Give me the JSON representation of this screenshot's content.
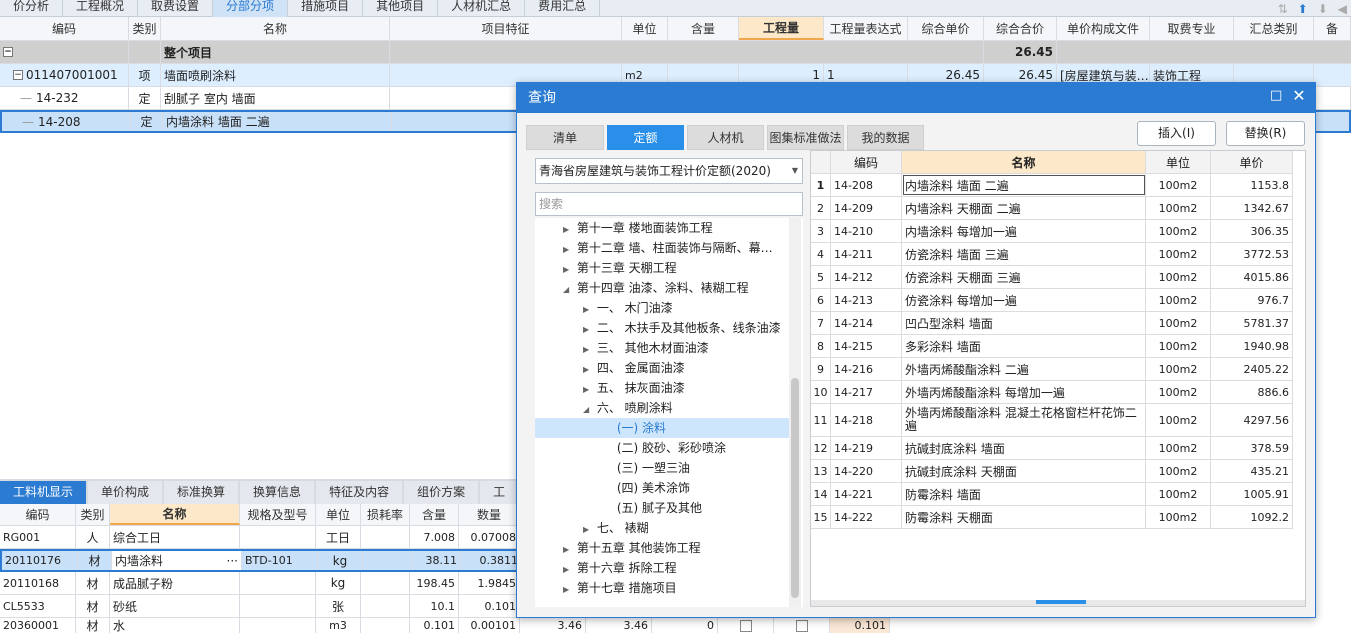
{
  "top_tabs": [
    "价分析",
    "工程概况",
    "取费设置",
    "分部分项",
    "措施项目",
    "其他项目",
    "人材机汇总",
    "费用汇总"
  ],
  "top_active": 3,
  "main_headers": [
    "编码",
    "类别",
    "名称",
    "项目特征",
    "单位",
    "含量",
    "工程量",
    "工程量表达式",
    "综合单价",
    "综合合价",
    "单价构成文件",
    "取费专业",
    "汇总类别",
    "备"
  ],
  "main_rows": {
    "total": {
      "toggle": "−",
      "name": "整个项目",
      "hj": "26.45"
    },
    "r1": {
      "toggle": "−",
      "code": "011407001001",
      "type": "项",
      "name": "墙面喷刷涂料",
      "unit": "m2",
      "qty": "1",
      "expr": "1",
      "price": "26.45",
      "total": "26.45",
      "file": "[房屋建筑与装…",
      "prof": "装饰工程"
    },
    "r2": {
      "code": "14-232",
      "type": "定",
      "name": "刮腻子 室内 墙面"
    },
    "r3": {
      "code": "14-208",
      "type": "定",
      "name": "内墙涂料 墙面 二遍"
    }
  },
  "bottom_tabs": [
    "工料机显示",
    "单价构成",
    "标准换算",
    "换算信息",
    "特征及内容",
    "组价方案",
    "工"
  ],
  "bottom_headers": [
    "编码",
    "类别",
    "名称",
    "规格及型号",
    "单位",
    "损耗率",
    "含量",
    "数量"
  ],
  "bottom_rows": [
    {
      "code": "RG001",
      "type": "人",
      "name": "综合工日",
      "spec": "",
      "unit": "工日",
      "loss": "",
      "content": "7.008",
      "qty": "0.07008"
    },
    {
      "code": "20110176",
      "type": "材",
      "name": "内墙涂料",
      "spec": "BTD-101",
      "unit": "kg",
      "loss": "",
      "content": "38.11",
      "qty": "0.3811"
    },
    {
      "code": "20110168",
      "type": "材",
      "name": "成品腻子粉",
      "spec": "",
      "unit": "kg",
      "loss": "",
      "content": "198.45",
      "qty": "1.9845"
    },
    {
      "code": "CL5533",
      "type": "材",
      "name": "砂纸",
      "spec": "",
      "unit": "张",
      "loss": "",
      "content": "10.1",
      "qty": "0.101"
    },
    {
      "code": "20360001",
      "type": "材",
      "name": "水",
      "spec": "",
      "unit": "m3",
      "loss": "",
      "content": "0.101",
      "qty": "0.00101",
      "extra1": "3.46",
      "extra2": "3.46",
      "extra3": "0",
      "extra4": "0.101"
    }
  ],
  "dialog": {
    "title": "查询",
    "tabs": [
      "清单",
      "定额",
      "人材机",
      "图集标准做法",
      "我的数据"
    ],
    "active_tab": 1,
    "insert_btn": "插入(I)",
    "replace_btn": "替换(R)",
    "library": "青海省房屋建筑与装饰工程计价定额(2020)",
    "search_placeholder": "搜索",
    "tree": [
      {
        "label": "第十一章 楼地面装饰工程",
        "arrow": "▶",
        "level": 0
      },
      {
        "label": "第十二章 墙、柱面装饰与隔断、幕…",
        "arrow": "▶",
        "level": 0
      },
      {
        "label": "第十三章 天棚工程",
        "arrow": "▶",
        "level": 0
      },
      {
        "label": "第十四章 油漆、涂料、裱糊工程",
        "arrow": "◢",
        "level": 0
      },
      {
        "label": "一、 木门油漆",
        "arrow": "▶",
        "level": 1
      },
      {
        "label": "二、 木扶手及其他板条、线条油漆",
        "arrow": "▶",
        "level": 1
      },
      {
        "label": "三、 其他木材面油漆",
        "arrow": "▶",
        "level": 1
      },
      {
        "label": "四、 金属面油漆",
        "arrow": "▶",
        "level": 1
      },
      {
        "label": "五、 抹灰面油漆",
        "arrow": "▶",
        "level": 1
      },
      {
        "label": "六、 喷刷涂料",
        "arrow": "◢",
        "level": 1
      },
      {
        "label": "(一) 涂料",
        "arrow": "",
        "level": 2
      },
      {
        "label": "(二) 胶砂、彩砂喷涂",
        "arrow": "",
        "level": 2
      },
      {
        "label": "(三) 一塑三油",
        "arrow": "",
        "level": 2
      },
      {
        "label": "(四) 美术涂饰",
        "arrow": "",
        "level": 2
      },
      {
        "label": "(五) 腻子及其他",
        "arrow": "",
        "level": 2
      },
      {
        "label": "七、 裱糊",
        "arrow": "▶",
        "level": 1
      },
      {
        "label": "第十五章 其他装饰工程",
        "arrow": "▶",
        "level": 0
      },
      {
        "label": "第十六章 拆除工程",
        "arrow": "▶",
        "level": 0
      },
      {
        "label": "第十七章 措施项目",
        "arrow": "▶",
        "level": 0
      }
    ],
    "tree_selected": 10,
    "grid_headers": [
      "编码",
      "名称",
      "单位",
      "单价"
    ],
    "grid_rows": [
      {
        "n": "1",
        "code": "14-208",
        "name": "内墙涂料 墙面 二遍",
        "unit": "100m2",
        "price": "1153.8"
      },
      {
        "n": "2",
        "code": "14-209",
        "name": "内墙涂料 天棚面 二遍",
        "unit": "100m2",
        "price": "1342.67"
      },
      {
        "n": "3",
        "code": "14-210",
        "name": "内墙涂料 每增加一遍",
        "unit": "100m2",
        "price": "306.35"
      },
      {
        "n": "4",
        "code": "14-211",
        "name": "仿瓷涂料 墙面 三遍",
        "unit": "100m2",
        "price": "3772.53"
      },
      {
        "n": "5",
        "code": "14-212",
        "name": "仿瓷涂料 天棚面 三遍",
        "unit": "100m2",
        "price": "4015.86"
      },
      {
        "n": "6",
        "code": "14-213",
        "name": "仿瓷涂料 每增加一遍",
        "unit": "100m2",
        "price": "976.7"
      },
      {
        "n": "7",
        "code": "14-214",
        "name": "凹凸型涂料 墙面",
        "unit": "100m2",
        "price": "5781.37"
      },
      {
        "n": "8",
        "code": "14-215",
        "name": "多彩涂料 墙面",
        "unit": "100m2",
        "price": "1940.98"
      },
      {
        "n": "9",
        "code": "14-216",
        "name": "外墙丙烯酸酯涂料 二遍",
        "unit": "100m2",
        "price": "2405.22"
      },
      {
        "n": "10",
        "code": "14-217",
        "name": "外墙丙烯酸酯涂料 每增加一遍",
        "unit": "100m2",
        "price": "886.6"
      },
      {
        "n": "11",
        "code": "14-218",
        "name": "外墙丙烯酸酯涂料 混凝土花格窗栏杆花饰二遍",
        "unit": "100m2",
        "price": "4297.56"
      },
      {
        "n": "12",
        "code": "14-219",
        "name": "抗碱封底涂料 墙面",
        "unit": "100m2",
        "price": "378.59"
      },
      {
        "n": "13",
        "code": "14-220",
        "name": "抗碱封底涂料 天棚面",
        "unit": "100m2",
        "price": "435.21"
      },
      {
        "n": "14",
        "code": "14-221",
        "name": "防霉涂料 墙面",
        "unit": "100m2",
        "price": "1005.91"
      },
      {
        "n": "15",
        "code": "14-222",
        "name": "防霉涂料 天棚面",
        "unit": "100m2",
        "price": "1092.2"
      }
    ]
  }
}
